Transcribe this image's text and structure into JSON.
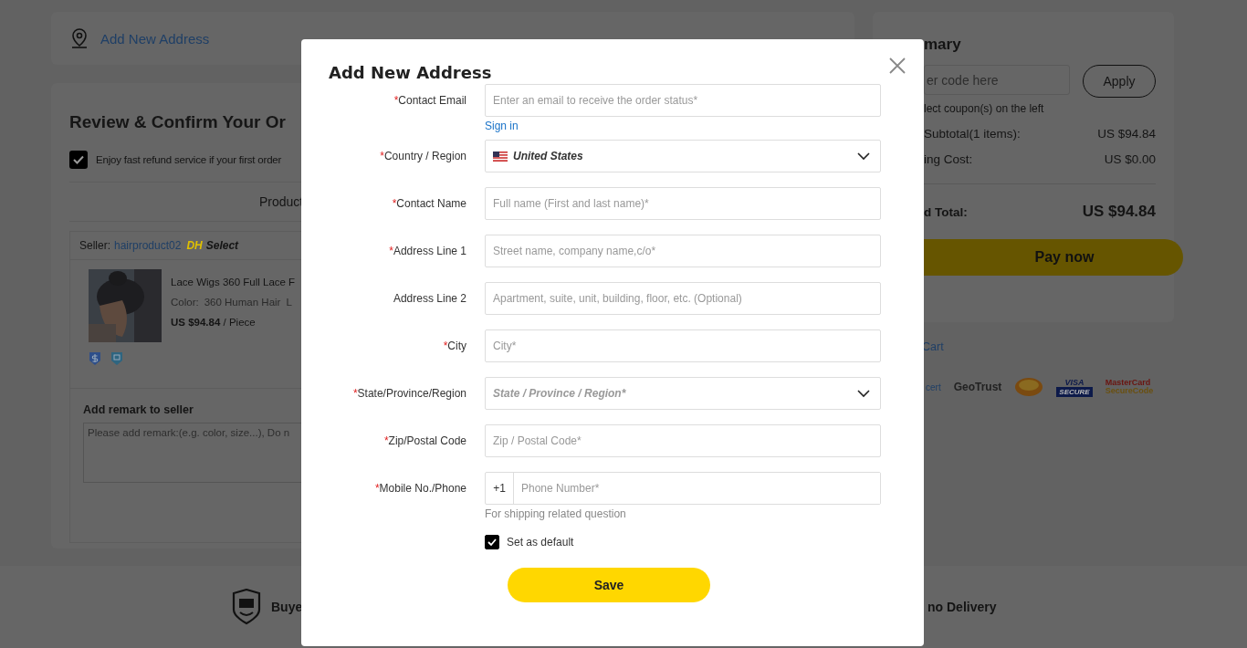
{
  "page": {
    "address_card": {
      "link": "Add New Address"
    },
    "review": {
      "title": "Review & Confirm Your Or",
      "refund": {
        "label": "Enjoy fast refund service if your first order",
        "checked": true
      },
      "table_header": "Product",
      "seller": {
        "prefix": "Seller:",
        "name": "hairproduct02",
        "badge_dh": "DH",
        "badge_select": "Select"
      },
      "item": {
        "title": "Lace Wigs 360 Full Lace F",
        "color_label": "Color:",
        "color_value": "360 Human Hair",
        "extra": "L",
        "price": "US $94.84",
        "unit": "/ Piece"
      },
      "remark": {
        "label": "Add remark to seller",
        "placeholder": "Please add remark:(e.g. color, size...), Do n"
      }
    },
    "summary": {
      "title": "mary",
      "coupon_placeholder": "er code here",
      "apply": "Apply",
      "coupon_hint": "lect coupon(s) on the left",
      "rows": [
        {
          "label": "Subtotal(1 items):",
          "value": "US $94.84"
        },
        {
          "label": "ing Cost:",
          "value": "US $0.00"
        }
      ],
      "total_label": "d Total:",
      "total": "US $94.84",
      "pay": "Pay now"
    },
    "cart_link": "Cart",
    "trust_badges": [
      {
        "kind": "cert",
        "text": "cert"
      },
      {
        "kind": "geotrust",
        "text": "GeoTrust"
      },
      {
        "kind": "seal"
      },
      {
        "kind": "visa",
        "text": "VISA",
        "sub": "SECURE"
      },
      {
        "kind": "mastercard",
        "text": "MasterCard",
        "sub": "SecureCode"
      }
    ],
    "footer": {
      "item_1": "Buye",
      "item_2": "no Delivery"
    }
  },
  "dialog": {
    "title": "Add New Address",
    "fields": [
      {
        "kind": "text",
        "mark": "*",
        "label": "Contact Email",
        "placeholder": "Enter an email to receive the order status*",
        "link": "Sign in"
      },
      {
        "kind": "select",
        "mark": "*",
        "label": "Country / Region",
        "value": "United States",
        "flag": true
      },
      {
        "kind": "text",
        "mark": "*",
        "label": "Contact Name",
        "placeholder": "Full name (First and last name)*"
      },
      {
        "kind": "text",
        "mark": "*",
        "label": "Address Line 1",
        "placeholder": "Street name, company name,c/o*"
      },
      {
        "kind": "text",
        "label": "Address Line 2",
        "placeholder": "Apartment, suite, unit, building, floor, etc. (Optional)"
      },
      {
        "kind": "text",
        "mark": "*",
        "label": "City",
        "placeholder": "City*"
      },
      {
        "kind": "select",
        "mark": "*",
        "label": "State/Province/Region",
        "placeholder": "State / Province / Region*"
      },
      {
        "kind": "text",
        "mark": "*",
        "label": "Zip/Postal Code",
        "placeholder": "Zip / Postal Code*"
      },
      {
        "kind": "phone",
        "mark": "*",
        "label": "Mobile No./Phone",
        "prefix": "+1",
        "placeholder": "Phone Number*",
        "hint": "For shipping related question"
      }
    ],
    "default": {
      "label": "Set as default",
      "checked": true
    },
    "save": "Save"
  }
}
